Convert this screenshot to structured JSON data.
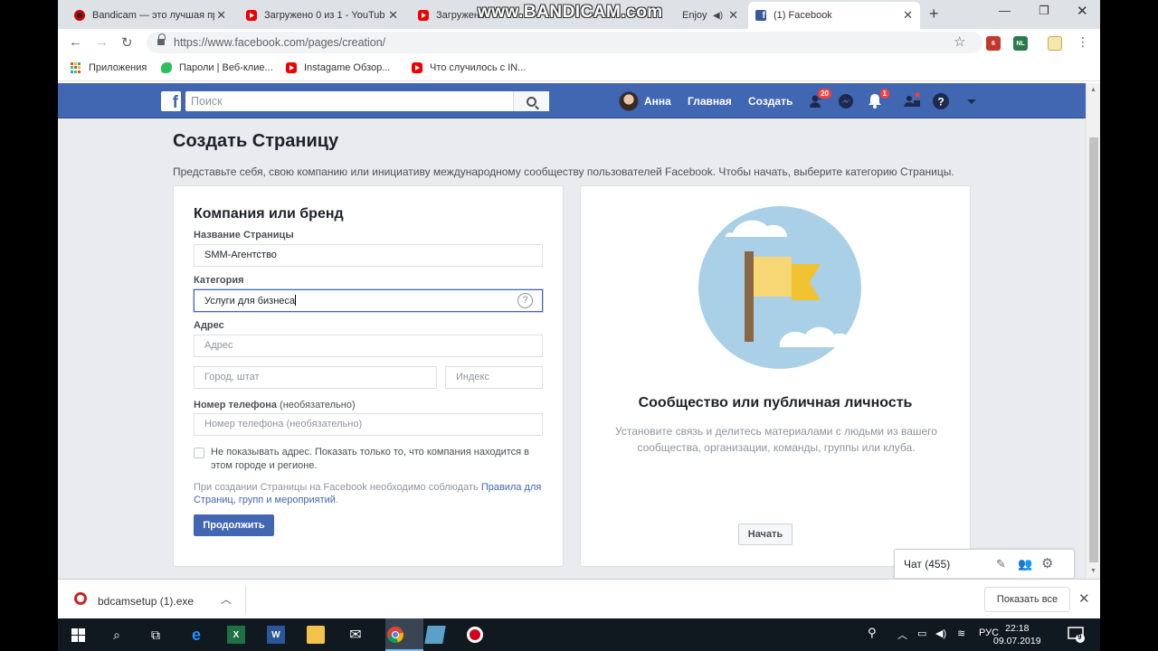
{
  "browser": {
    "tabs": [
      {
        "title": "Bandicam — это лучшая пр",
        "icon": "bandicam-icon"
      },
      {
        "title": "Загружено 0 из 1 - YouTub",
        "icon": "youtube-icon"
      },
      {
        "title": "Загружено",
        "icon": "youtube-icon"
      },
      {
        "title": "Enjoy",
        "icon": "audio-icon"
      },
      {
        "title": "(1) Facebook",
        "icon": "facebook-icon",
        "active": true
      }
    ],
    "watermark": "www.BANDICAM.com",
    "url": "https://www.facebook.com/pages/creation/",
    "bookmarks": [
      {
        "label": "Приложения",
        "icon": "apps-grid-icon"
      },
      {
        "label": "Пароли | Веб-клие...",
        "icon": "evernote-icon"
      },
      {
        "label": "Instagame Обзор...",
        "icon": "youtube-icon"
      },
      {
        "label": "Что случилось с IN...",
        "icon": "youtube-icon"
      }
    ],
    "extensions": {
      "abp_badge": "6",
      "nl_badge": "NL"
    }
  },
  "fb": {
    "search_placeholder": "Поиск",
    "user": "Анна",
    "home": "Главная",
    "create": "Создать",
    "friend_requests_badge": "20",
    "notifications_badge": "1"
  },
  "page": {
    "title": "Создать Страницу",
    "description": "Представьте себя, свою компанию или инициативу международному сообществу пользователей Facebook. Чтобы начать, выберите категорию Страницы."
  },
  "form": {
    "heading": "Компания или бренд",
    "name_label": "Название Страницы",
    "name_value": "SMM-Агентство",
    "category_label": "Категория",
    "category_value": "Услуги для бизнеса",
    "address_label": "Адрес",
    "address_placeholder": "Адрес",
    "city_placeholder": "Город, штат",
    "zip_placeholder": "Индекс",
    "phone_label": "Номер телефона",
    "phone_optional": "(необязательно)",
    "phone_placeholder": "Номер телефона (необязательно)",
    "hide_address_label": "Не показывать адрес. Показать только то, что компания находится в этом городе и регионе.",
    "hide_address_checked": false,
    "terms_text": "При создании Страницы на Facebook необходимо соблюдать ",
    "terms_link": "Правила для Страниц, групп и мероприятий",
    "terms_end": ".",
    "continue_button": "Продолжить"
  },
  "community": {
    "title": "Сообщество или публичная личность",
    "description": "Установите связь и делитесь материалами с людьми из вашего сообщества, организации, команды, группы или клуба.",
    "start_button": "Начать"
  },
  "chat": {
    "label": "Чат (455)"
  },
  "download": {
    "filename": "bdcamsetup (1).exe",
    "show_all": "Показать все"
  },
  "taskbar": {
    "language": "РУС",
    "time": "22:18",
    "date": "09.07.2019",
    "notification_count": "9"
  }
}
